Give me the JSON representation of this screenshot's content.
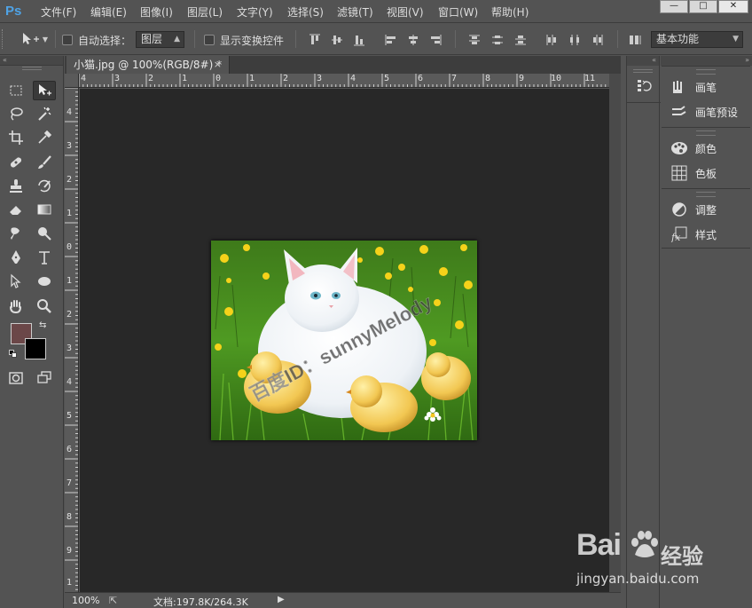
{
  "app": {
    "logo": "Ps"
  },
  "menu": [
    "文件(F)",
    "编辑(E)",
    "图像(I)",
    "图层(L)",
    "文字(Y)",
    "选择(S)",
    "滤镜(T)",
    "视图(V)",
    "窗口(W)",
    "帮助(H)"
  ],
  "window_controls": [
    "—",
    "□",
    "✕"
  ],
  "options": {
    "auto_select_label": "自动选择：",
    "auto_select_value": "图层",
    "show_transform_label": "显示变换控件",
    "workspace_value": "基本功能"
  },
  "document": {
    "tab_title": "小猫.jpg @ 100%(RGB/8#) *",
    "close_glyph": "×",
    "zoom": "100%",
    "doc_size": "文档:197.8K/264.3K",
    "status_arrow": "▶"
  },
  "rulers": {
    "top_labels": [
      "4",
      "3",
      "2",
      "1",
      "0",
      "1",
      "2",
      "3",
      "4",
      "5",
      "6",
      "7",
      "8",
      "9",
      "10",
      "11"
    ],
    "left_labels": [
      "4",
      "3",
      "2",
      "1",
      "0",
      "1",
      "2",
      "3",
      "4",
      "5",
      "6",
      "7",
      "8",
      "9",
      "1"
    ]
  },
  "photo": {
    "watermark_text": "百度ID：sunnyMelody"
  },
  "right_panels": [
    {
      "items": [
        {
          "icon": "brush-icon",
          "label": "画笔"
        },
        {
          "icon": "brush-presets-icon",
          "label": "画笔预设"
        }
      ]
    },
    {
      "items": [
        {
          "icon": "color-palette-icon",
          "label": "颜色"
        },
        {
          "icon": "swatches-icon",
          "label": "色板"
        }
      ]
    },
    {
      "items": [
        {
          "icon": "adjustments-icon",
          "label": "调整"
        },
        {
          "icon": "fx-styles-icon",
          "label": "样式"
        }
      ]
    }
  ],
  "colors": {
    "foreground": "#6b4748",
    "background": "#000000",
    "ui_bg": "#535353",
    "canvas_bg": "#282828",
    "ps_blue": "#4fa3e6"
  },
  "watermark": {
    "logo": "Bai",
    "logo_cn": "经验",
    "url": "jingyan.baidu.com"
  }
}
